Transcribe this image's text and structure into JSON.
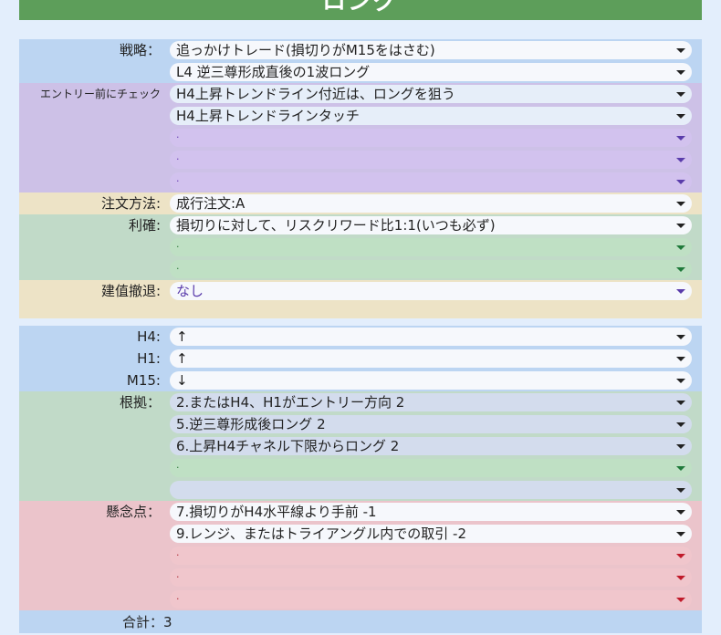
{
  "header": {
    "title": "ロング"
  },
  "labels": {
    "strategy": "戦略：",
    "check": "エントリー前にチェック",
    "order": "注文方法:",
    "profit": "利確:",
    "breakeven": "建值撤退:",
    "h4": "H4:",
    "h1": "H1:",
    "m15": "M15:",
    "basis": "根拠：",
    "concern": "懸念点：",
    "total": "合計：3"
  },
  "strategy": [
    "追っかけトレード(損切りがM15をはさむ)",
    "L4 逆三尊形成直後の1波ロング"
  ],
  "check": [
    "H4上昇トレンドライン付近は、ロングを狙う",
    "H4上昇トレンドラインタッチ",
    ".",
    ".",
    "."
  ],
  "order": "成行注文:A",
  "profit": [
    "損切りに対して、リスクリワード比1:1(いつも必ず)",
    ".",
    "."
  ],
  "breakeven": "なし",
  "timeframes": {
    "h4": "↑",
    "h1": "↑",
    "m15": "↓"
  },
  "basis": [
    "2.またはH4、H1がエントリー方向  2",
    "5.逆三尊形成後ロング  2",
    "6.上昇H4チャネル下限からロング  2",
    ".",
    ""
  ],
  "concern": [
    "7.損切りがH4水平線より手前  -1",
    "9.レンジ、またはトライアングル内での取引  -2",
    ".",
    ".",
    "."
  ],
  "colors": {
    "header": "#5d9e5a",
    "strategy_bg": "#bcd5f2",
    "check_bg": "#cdc1e7",
    "order_bg": "#ede3c6",
    "profit_bg": "#c1dac8",
    "concern_bg": "#ebc4cb"
  }
}
